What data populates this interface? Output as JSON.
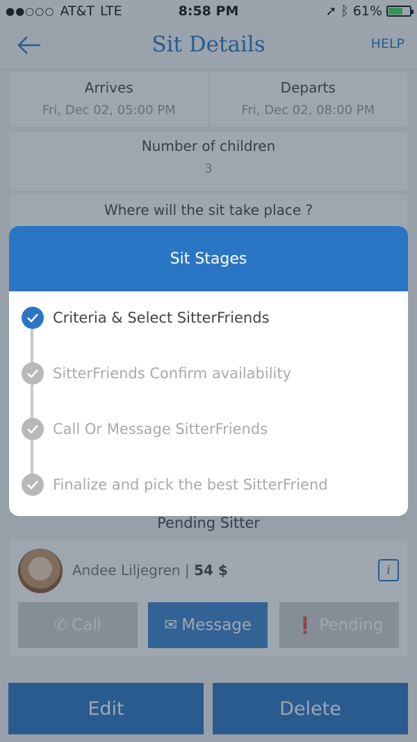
{
  "status_bar": {
    "carrier": "AT&T",
    "network": "LTE",
    "time": "8:58 PM",
    "battery": "61%"
  },
  "header": {
    "title": "Sit Details",
    "help": "HELP"
  },
  "times": {
    "arrives_label": "Arrives",
    "arrives_value": "Fri, Dec 02, 05:00 PM",
    "departs_label": "Departs",
    "departs_value": "Fri, Dec 02, 08:00 PM"
  },
  "children": {
    "label": "Number of children",
    "value": "3"
  },
  "location": {
    "label": "Where will the sit take place ?"
  },
  "pending": {
    "title": "Pending Sitter",
    "sitter_name": "Andee Liljegren",
    "separator": "|",
    "rate": "54 $",
    "info_label": "i",
    "call": "Call",
    "message": "Message",
    "pending": "Pending"
  },
  "actions": {
    "edit": "Edit",
    "delete": "Delete"
  },
  "modal": {
    "title": "Sit Stages",
    "stages": [
      {
        "label": "Criteria & Select SitterFriends",
        "active": true
      },
      {
        "label": "SitterFriends Confirm availability",
        "active": false
      },
      {
        "label": "Call Or Message SitterFriends",
        "active": false
      },
      {
        "label": "Finalize and pick the best SitterFriend",
        "active": false
      }
    ]
  },
  "colors": {
    "accent": "#2b76c4",
    "inactive": "#b8b8b8",
    "battery": "#4cd964"
  }
}
